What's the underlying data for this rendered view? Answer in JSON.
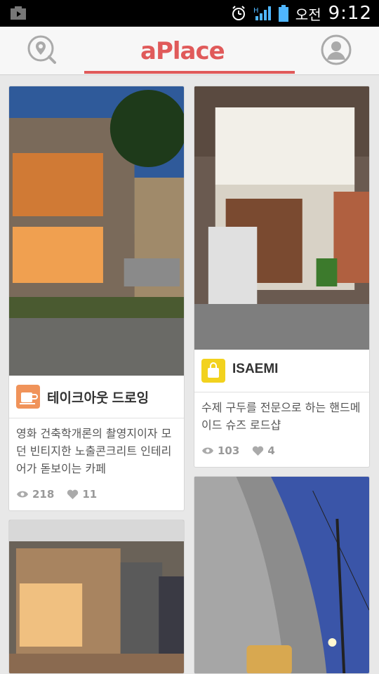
{
  "status_bar": {
    "ampm": "오전",
    "time": "9:12",
    "icons": [
      "notification-icon",
      "alarm-icon",
      "signal-icon",
      "battery-icon"
    ]
  },
  "app_bar": {
    "logo_text": "aPlace",
    "left_icon": "location-search-icon",
    "right_icon": "profile-icon",
    "accent_color": "#e05a5a"
  },
  "cards": [
    {
      "title": "테이크아웃 드로잉",
      "category_icon": "coffee-cup-icon",
      "category_color": "#f0935a",
      "description": "영화 건축학개론의 촬영지이자 모던 빈티지한 노출콘크리트 인테리어가 돋보이는 카페",
      "views": "218",
      "likes": "11"
    },
    {
      "title": "ISAEMI",
      "category_icon": "shopping-bag-icon",
      "category_color": "#f2d21e",
      "description": "수제 구두를 전문으로 하는 핸드메이드 슈즈 로드샵",
      "views": "103",
      "likes": "4"
    },
    {
      "title": "",
      "category_icon": "",
      "description": "",
      "views": "",
      "likes": ""
    },
    {
      "title": "",
      "category_icon": "",
      "description": "",
      "views": "",
      "likes": ""
    }
  ]
}
